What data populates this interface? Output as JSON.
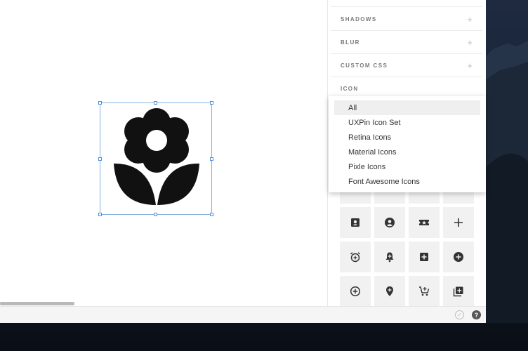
{
  "panel": {
    "sections": [
      {
        "label": "SHADOWS",
        "action": "+"
      },
      {
        "label": "BLUR",
        "action": "+"
      },
      {
        "label": "CUSTOM CSS",
        "action": "+"
      },
      {
        "label": "ICON",
        "action": ""
      }
    ]
  },
  "icon_set_dropdown": {
    "options": [
      "All",
      "UXPin Icon Set",
      "Retina Icons",
      "Material Icons",
      "Pixle Icons",
      "Font Awesome Icons"
    ],
    "selected": "All"
  },
  "icon_grid": [
    "contact-card-icon",
    "account-circle-icon",
    "ticket-icon",
    "plus-icon",
    "add-alarm-icon",
    "add-alert-icon",
    "add-box-icon",
    "add-circle-icon",
    "add-circle-outline-icon",
    "add-location-icon",
    "add-shopping-cart-icon",
    "add-to-library-icon"
  ],
  "statusbar": {
    "check": "✓",
    "help": "?"
  },
  "colors": {
    "selection": "#4a8fe0",
    "icon": "#111111",
    "tile": "#f1f1f1"
  }
}
